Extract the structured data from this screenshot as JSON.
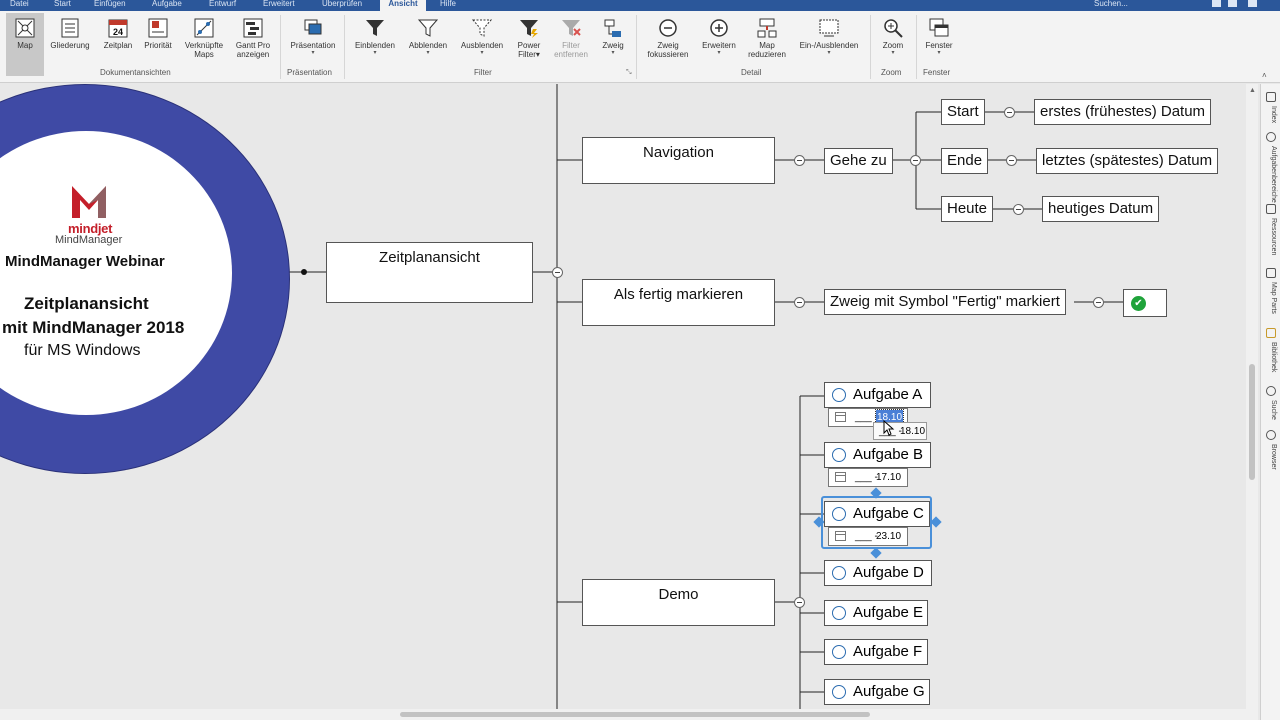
{
  "menubar": {
    "tabs": [
      "Datei",
      "Start",
      "Einfügen",
      "Aufgabe",
      "Entwurf",
      "Erweitert",
      "Überprüfen",
      "Ansicht",
      "Hilfe"
    ],
    "active_tab": "Ansicht",
    "search_label": "Suchen..."
  },
  "ribbon": {
    "groups": {
      "dokumentansichten": "Dokumentansichten",
      "praesentation": "Präsentation",
      "filter": "Filter",
      "detail": "Detail",
      "zoom": "Zoom",
      "fenster": "Fenster"
    },
    "buttons": {
      "map": "Map",
      "gliederung": "Gliederung",
      "zeitplan": "Zeitplan",
      "prioritaet": "Priorität",
      "verknuepfte_maps_1": "Verknüpfte",
      "verknuepfte_maps_2": "Maps",
      "gantt_1": "Gantt Pro",
      "gantt_2": "anzeigen",
      "praesentation": "Präsentation",
      "einblenden": "Einblenden",
      "abblenden": "Abblenden",
      "ausblenden": "Ausblenden",
      "power_filter_1": "Power",
      "power_filter_2": "Filter",
      "filter_entfernen_1": "Filter",
      "filter_entfernen_2": "entfernen",
      "zweig": "Zweig",
      "zweig_fokus_1": "Zweig",
      "zweig_fokus_2": "fokussieren",
      "erweitern": "Erweitern",
      "map_reduzieren_1": "Map",
      "map_reduzieren_2": "reduzieren",
      "ein_ausblenden": "Ein-/Ausblenden",
      "zoom": "Zoom",
      "fenster": "Fenster",
      "calendar_day": "24"
    }
  },
  "central": {
    "logo_text": "mindjet",
    "logo_sub": "MindManager",
    "title": "MindManager Webinar",
    "line1": "Zeitplanansicht",
    "line2": "mit MindManager 2018",
    "line3": "für MS Windows"
  },
  "topics": {
    "zeitplanansicht": "Zeitplanansicht",
    "navigation": "Navigation",
    "gehe_zu": "Gehe zu",
    "start": "Start",
    "ende": "Ende",
    "heute": "Heute",
    "start_desc": "erstes (frühestes) Datum",
    "ende_desc": "letztes (spätestes) Datum",
    "heute_desc": "heutiges Datum",
    "fertig": "Als fertig markieren",
    "fertig_desc": "Zweig mit Symbol \"Fertig\" markiert",
    "demo": "Demo"
  },
  "tasks": [
    {
      "label": "Aufgabe A",
      "date_prefix": "___ -",
      "date": "18.10"
    },
    {
      "label": "Aufgabe B",
      "date_prefix": "___ -",
      "date": "17.10"
    },
    {
      "label": "Aufgabe C",
      "date_prefix": "___ -",
      "date": "23.10"
    },
    {
      "label": "Aufgabe D"
    },
    {
      "label": "Aufgabe E"
    },
    {
      "label": "Aufgabe F"
    },
    {
      "label": "Aufgabe G"
    }
  ],
  "tooltip": {
    "prefix": "___ -",
    "date": "18.10"
  },
  "sidepanel": [
    "Index",
    "Aufgabenbereiche",
    "Ressourcen",
    "Map Parts",
    "Bibliothek",
    "Suche",
    "Browser"
  ],
  "colors": {
    "ribbon_blue": "#2b579a",
    "ring": "#3f4aa5",
    "accent_select": "#4a90d9",
    "done_green": "#1fa33a"
  }
}
